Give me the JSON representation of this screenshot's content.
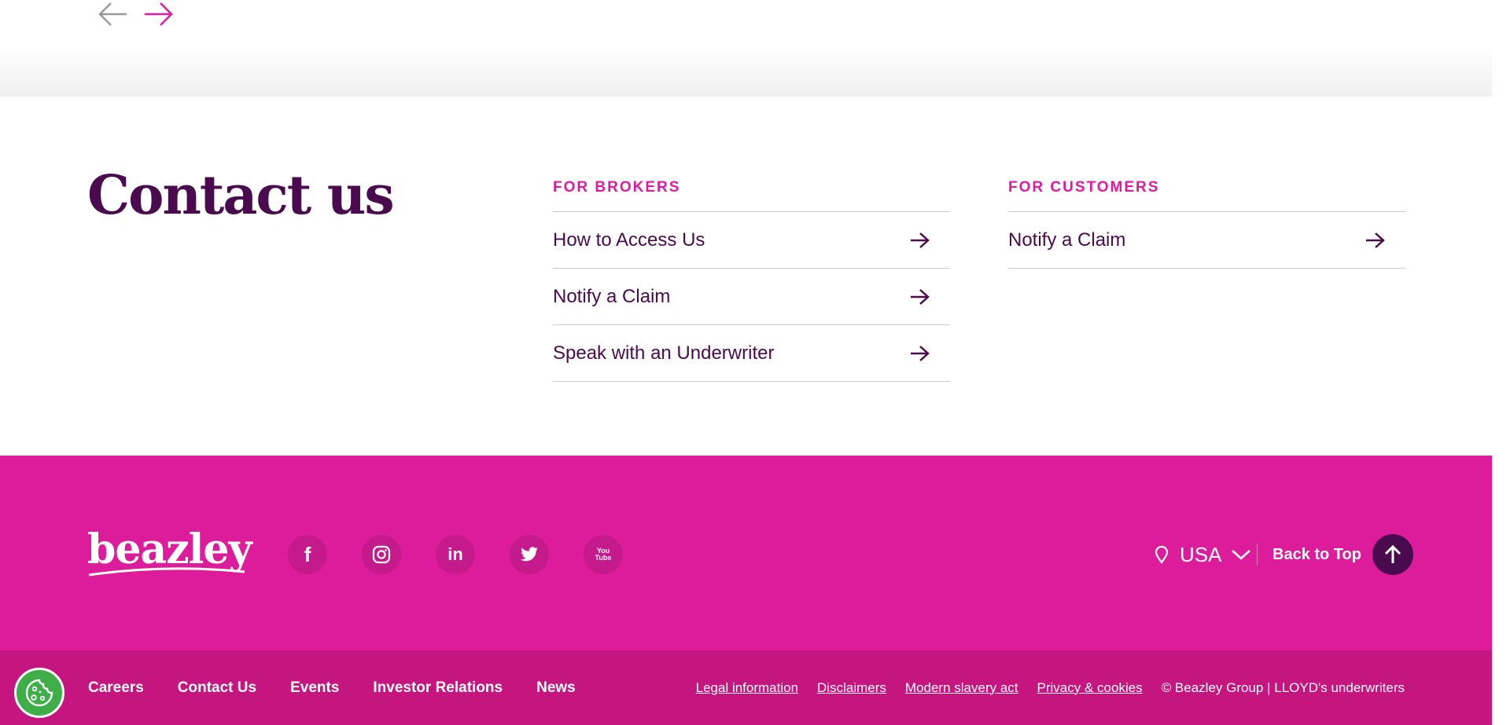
{
  "carousel": {
    "prev_icon": "arrow-left-icon",
    "next_icon": "arrow-right-icon",
    "prev_color": "#9a9a9a",
    "next_color": "#de1b9c"
  },
  "contact": {
    "title": "Contact us",
    "brokers": {
      "heading": "FOR BROKERS",
      "links": [
        {
          "label": "How to Access Us"
        },
        {
          "label": "Notify a Claim"
        },
        {
          "label": "Speak with an Underwriter"
        }
      ]
    },
    "customers": {
      "heading": "FOR CUSTOMERS",
      "links": [
        {
          "label": "Notify a Claim"
        }
      ]
    }
  },
  "footer": {
    "logo_text": "beazley",
    "social": [
      {
        "icon": "facebook-icon",
        "glyph": "f"
      },
      {
        "icon": "instagram-icon",
        "glyph": ""
      },
      {
        "icon": "linkedin-icon",
        "glyph": "in"
      },
      {
        "icon": "twitter-icon",
        "glyph": ""
      },
      {
        "icon": "youtube-icon",
        "glyph": "You Tube"
      }
    ],
    "location": "USA",
    "back_to_top": "Back to Top",
    "nav": [
      "Careers",
      "Contact Us",
      "Events",
      "Investor Relations",
      "News"
    ],
    "legal": [
      "Legal information",
      "Disclaimers",
      "Modern slavery act",
      "Privacy & cookies"
    ],
    "copyright": "© Beazley Group | LLOYD's underwriters"
  },
  "colors": {
    "brand_pink": "#dd1c9b",
    "brand_pink_dark": "#c5157f",
    "brand_purple": "#4a0a4e",
    "cookie_green": "#3fae49"
  }
}
